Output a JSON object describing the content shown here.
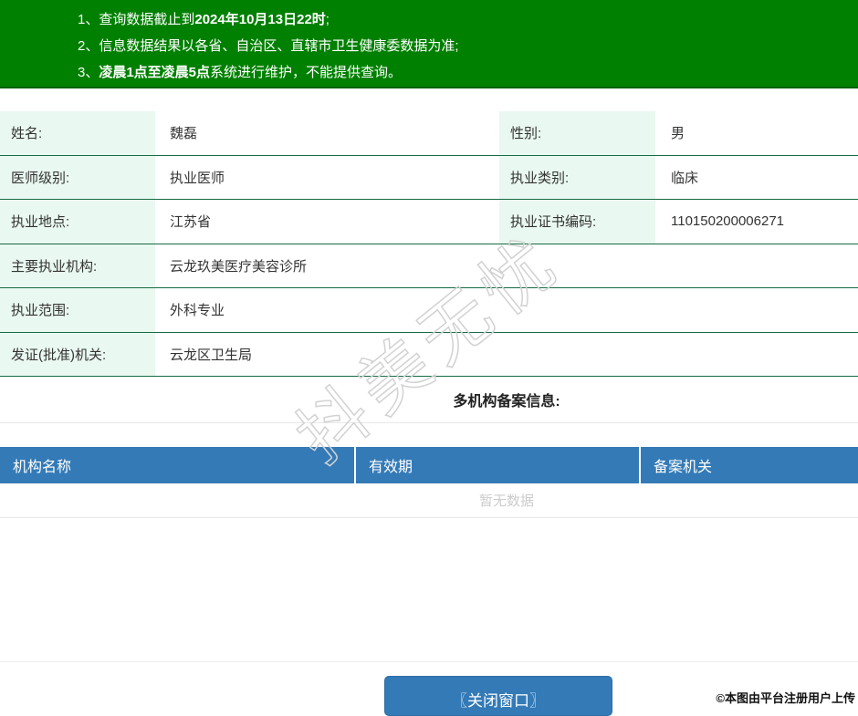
{
  "banner": {
    "line1_num": "1、",
    "line1_pre": "查询数据截止到",
    "line1_bold": "2024年10月13日22时",
    "line1_post": ";",
    "line2_num": "2、",
    "line2_text": "信息数据结果以各省、自治区、直辖市卫生健康委数据为准;",
    "line3_num": "3、",
    "line3_bold": "凌晨1点至凌晨5点",
    "line3_post": "系统进行维护，不能提供查询。"
  },
  "details": {
    "rows_two_col": [
      {
        "l1": "姓名:",
        "v1": "魏磊",
        "l2": "性别:",
        "v2": "男"
      },
      {
        "l1": "医师级别:",
        "v1": "执业医师",
        "l2": "执业类别:",
        "v2": "临床"
      },
      {
        "l1": "执业地点:",
        "v1": "江苏省",
        "l2": "执业证书编码:",
        "v2": "110150200006271"
      }
    ],
    "rows_one_col": [
      {
        "l": "主要执业机构:",
        "v": "云龙玖美医疗美容诊所"
      },
      {
        "l": "执业范围:",
        "v": "外科专业"
      },
      {
        "l": "发证(批准)机关:",
        "v": "云龙区卫生局"
      }
    ]
  },
  "filing": {
    "heading": "多机构备案信息:",
    "columns": [
      "机构名称",
      "有效期",
      "备案机关"
    ],
    "empty_text": "暂无数据"
  },
  "footer": {
    "close_button_label": "〖关闭窗口〗",
    "credit_text": "©本图由平台注册用户上传"
  },
  "watermark_text": "抖美无忧",
  "colors": {
    "banner_green": "#008000",
    "row_divider_green": "#166c44",
    "label_cell_mint": "#e9f8f0",
    "table_header_blue": "#337ab7",
    "button_blue": "#337ab7",
    "empty_text_gray": "#cccccc"
  }
}
